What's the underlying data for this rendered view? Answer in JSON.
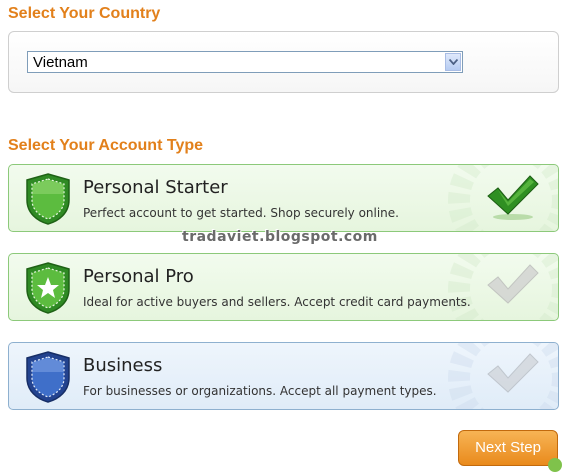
{
  "country": {
    "title": "Select Your Country",
    "selected": "Vietnam"
  },
  "account": {
    "title": "Select Your Account Type",
    "types": [
      {
        "title": "Personal Starter",
        "description": "Perfect account to get started. Shop securely online.",
        "selected": true
      },
      {
        "title": "Personal Pro",
        "description": "Ideal for active buyers and sellers. Accept credit card payments.",
        "selected": false
      },
      {
        "title": "Business",
        "description": "For businesses or organizations. Accept all payment types.",
        "selected": false
      }
    ]
  },
  "watermark": "tradaviet.blogspot.com",
  "actions": {
    "next": "Next Step"
  },
  "colors": {
    "heading": "#e2801b",
    "green": "#3b9a2c",
    "blue": "#2b56a8",
    "button": "#f0991f"
  },
  "icons": [
    "chevron-down-icon",
    "shield-icon",
    "shield-star-icon",
    "shield-blue-icon",
    "checkmark-icon"
  ]
}
